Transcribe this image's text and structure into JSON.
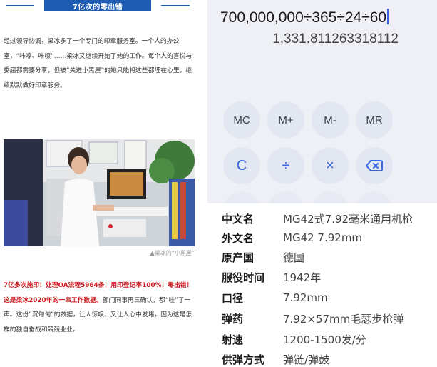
{
  "article": {
    "section_title": "7亿次的零出错",
    "para1": "经过领导协调，梁冰多了一个专门的印章服务室。一个人的办公室，“咔嚓、咔嚓”……梁冰又继续开始了她的工作。每个人的喜悦与委屈都需要分享，但被“关进小黑屋”的她只能将这些都埋在心里，继续默默做好印章服务。",
    "photo_caption": "▲梁冰的“小黑屋”",
    "para2_bold": "7亿多次施印！处理OA流程5964条！用印登记率100%！零出错！这是梁冰2020年的一串工作数据。",
    "para2_rest": "部门同事再三确认，都“哇”了一声。这份“沉甸甸”的数据，让人惊叹，又让人心中发堵，因为这是怎样的独自奋战和兢兢业业。"
  },
  "calculator": {
    "expression": "700,000,000÷365÷24÷60",
    "result": "1,331.811263318112",
    "buttons": [
      {
        "label": "MC",
        "name": "memory-clear-button"
      },
      {
        "label": "M+",
        "name": "memory-add-button"
      },
      {
        "label": "M-",
        "name": "memory-subtract-button"
      },
      {
        "label": "MR",
        "name": "memory-recall-button"
      },
      {
        "label": "C",
        "name": "clear-button"
      },
      {
        "label": "÷",
        "name": "divide-button"
      },
      {
        "label": "×",
        "name": "multiply-button"
      },
      {
        "label": "",
        "name": "backspace-button",
        "icon": "backspace-icon"
      }
    ]
  },
  "infocard": {
    "rows": [
      {
        "label": "中文名",
        "value": "MG42式7.92毫米通用机枪"
      },
      {
        "label": "外文名",
        "value": "MG42 7.92mm"
      },
      {
        "label": "原产国",
        "value": "德国"
      },
      {
        "label": "服役时间",
        "value": "1942年"
      },
      {
        "label": "口径",
        "value": "7.92mm"
      },
      {
        "label": "弹药",
        "value": "7.92×57mm毛瑟步枪弹"
      },
      {
        "label": "射速",
        "value": "1200-1500发/分"
      },
      {
        "label": "供弹方式",
        "value": "弹链/弹鼓"
      }
    ]
  },
  "colors": {
    "title_band": "#1e5cb3",
    "highlight_red": "#c8191f",
    "calc_accent": "#3a66e0",
    "calc_background": "#eef0f6"
  }
}
